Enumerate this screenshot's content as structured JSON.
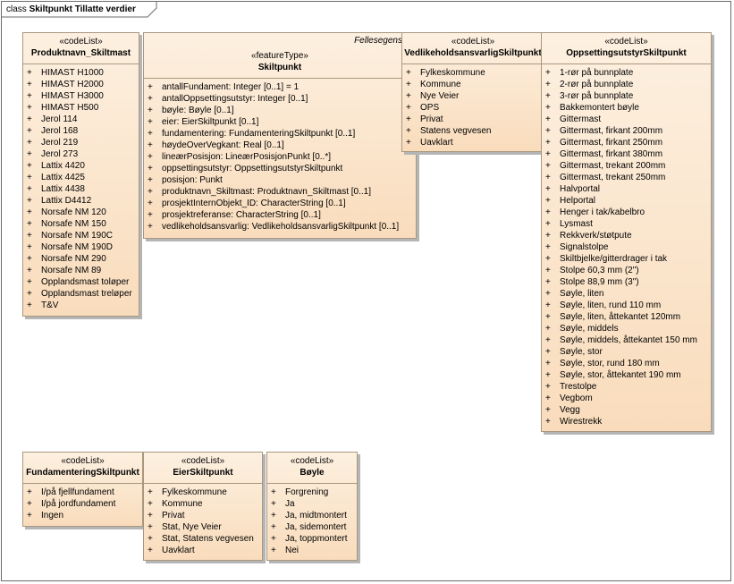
{
  "frame": {
    "keyword": "class",
    "name": "Skiltpunkt Tillatte verdier"
  },
  "visibility_symbol": "+",
  "classes": {
    "produktnavn": {
      "stereotype": "«codeList»",
      "name": "Produktnavn_Skiltmast",
      "items": [
        "HIMAST H1000",
        "HIMAST H2000",
        "HIMAST H3000",
        "HIMAST H500",
        "Jerol 114",
        "Jerol 168",
        "Jerol 219",
        "Jerol 273",
        "Lattix 4420",
        "Lattix 4425",
        "Lattix 4438",
        "Lattix D4412",
        "Norsafe NM 120",
        "Norsafe NM 150",
        "Norsafe NM 190C",
        "Norsafe NM 190D",
        "Norsafe NM 290",
        "Norsafe NM 89",
        "Opplandsmast toløper",
        "Opplandsmast treløper",
        "T&V"
      ]
    },
    "skiltpunkt": {
      "tagged": "Fellesegenskaper",
      "stereotype": "«featureType»",
      "name": "Skiltpunkt",
      "items": [
        "antallFundament: Integer [0..1] = 1",
        "antallOppsettingsutstyr: Integer [0..1]",
        "bøyle: Bøyle [0..1]",
        "eier: EierSkiltpunkt [0..1]",
        "fundamentering: FundamenteringSkiltpunkt [0..1]",
        "høydeOverVegkant: Real [0..1]",
        "lineærPosisjon: LineærPosisjonPunkt [0..*]",
        "oppsettingsutstyr: OppsettingsutstyrSkiltpunkt",
        "posisjon: Punkt",
        "produktnavn_Skiltmast: Produktnavn_Skiltmast [0..1]",
        "prosjektInternObjekt_ID: CharacterString [0..1]",
        "prosjektreferanse: CharacterString [0..1]",
        "vedlikeholdsansvarlig: VedlikeholdsansvarligSkiltpunkt [0..1]"
      ]
    },
    "vedlikehold": {
      "stereotype": "«codeList»",
      "name": "VedlikeholdsansvarligSkiltpunkt",
      "items": [
        "Fylkeskommune",
        "Kommune",
        "Nye Veier",
        "OPS",
        "Privat",
        "Statens vegvesen",
        "Uavklart"
      ]
    },
    "oppsetting": {
      "stereotype": "«codeList»",
      "name": "OppsettingsutstyrSkiltpunkt",
      "items": [
        "1-rør på bunnplate",
        "2-rør på bunnplate",
        "3-rør på bunnplate",
        "Bakkemontert bøyle",
        "Gittermast",
        "Gittermast, firkant 200mm",
        "Gittermast, firkant 250mm",
        "Gittermast, firkant 380mm",
        "Gittermast, trekant 200mm",
        "Gittermast, trekant 250mm",
        "Halvportal",
        "Helportal",
        "Henger i tak/kabelbro",
        "Lysmast",
        "Rekkverk/støtpute",
        "Signalstolpe",
        "Skiltbjelke/gitterdrager i tak",
        "Stolpe 60,3 mm (2\")",
        "Stolpe 88,9 mm (3\")",
        "Søyle, liten",
        "Søyle, liten, rund 110 mm",
        "Søyle, liten, åttekantet 120mm",
        "Søyle, middels",
        "Søyle, middels, åttekantet 150 mm",
        "Søyle, stor",
        "Søyle, stor, rund 180 mm",
        "Søyle, stor, åttekantet 190 mm",
        "Trestolpe",
        "Vegbom",
        "Vegg",
        "Wirestrekk"
      ]
    },
    "fundamentering": {
      "stereotype": "«codeList»",
      "name": "FundamenteringSkiltpunkt",
      "items": [
        "I/på fjellfundament",
        "I/på jordfundament",
        "Ingen"
      ]
    },
    "eier": {
      "stereotype": "«codeList»",
      "name": "EierSkiltpunkt",
      "items": [
        "Fylkeskommune",
        "Kommune",
        "Privat",
        "Stat, Nye Veier",
        "Stat, Statens vegvesen",
        "Uavklart"
      ]
    },
    "boyle": {
      "stereotype": "«codeList»",
      "name": "Bøyle",
      "items": [
        "Forgrening",
        "Ja",
        "Ja, midtmontert",
        "Ja, sidemontert",
        "Ja, toppmontert",
        "Nei"
      ]
    }
  }
}
